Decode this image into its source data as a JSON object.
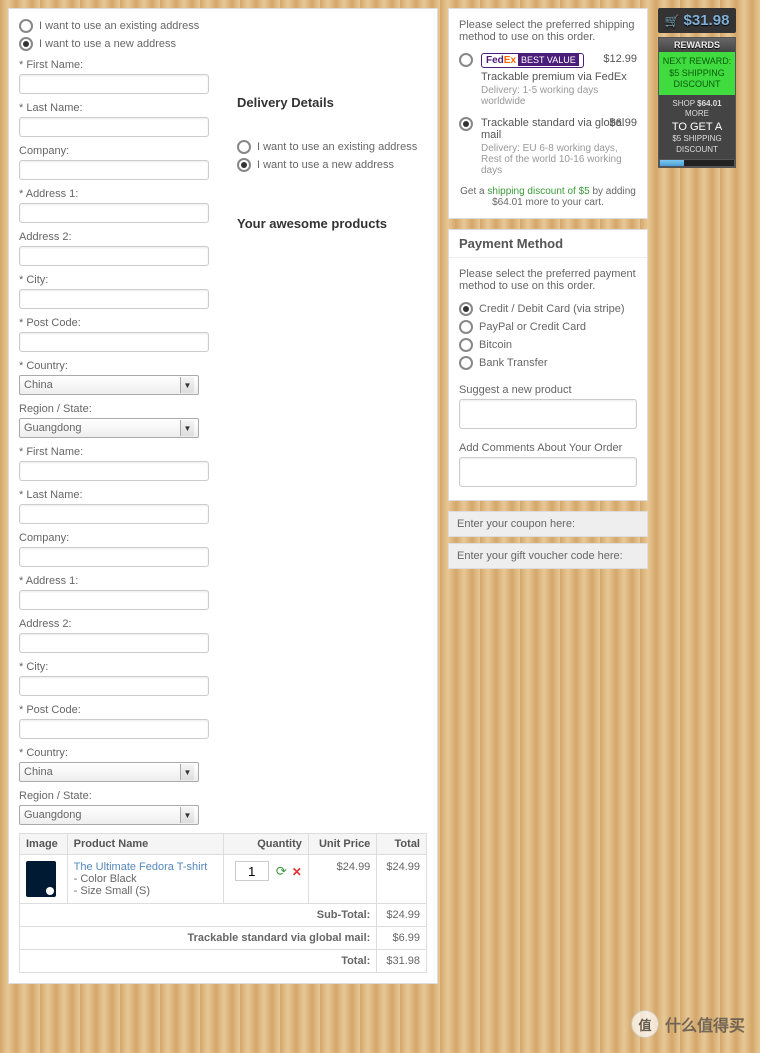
{
  "billing": {
    "use_existing": "I want to use an existing address",
    "use_new": "I want to use a new address",
    "first_name_label": "* First Name:",
    "last_name_label": "* Last Name:",
    "company_label": "Company:",
    "address1_label": "* Address 1:",
    "address2_label": "Address 2:",
    "city_label": "* City:",
    "postcode_label": "* Post Code:",
    "country_label": "* Country:",
    "country_value": "China",
    "region_label": "Region / State:",
    "region_value": "Guangdong"
  },
  "delivery": {
    "heading": "Delivery Details",
    "use_existing": "I want to use an existing address",
    "use_new": "I want to use a new address",
    "first_name_label": "* First Name:",
    "last_name_label": "* Last Name:",
    "company_label": "Company:",
    "address1_label": "* Address 1:",
    "address2_label": "Address 2:",
    "city_label": "* City:",
    "postcode_label": "* Post Code:",
    "country_label": "* Country:",
    "country_value": "China",
    "region_label": "Region / State:",
    "region_value": "Guangdong"
  },
  "products_heading": "Your awesome products",
  "shipping": {
    "instruction": "Please select the preferred shipping method to use on this order.",
    "fedex_brand": "FedEx",
    "fedex_best": "BEST VALUE",
    "fedex_title": "Trackable premium via FedEx",
    "fedex_sub": "Delivery: 1-5 working days worldwide",
    "fedex_price": "$12.99",
    "global_title": "Trackable standard via global mail",
    "global_sub": "Delivery: EU 6-8 working days, Rest of the world 10-16 working days",
    "global_price": "$6.99",
    "promo_pre": "Get a ",
    "promo_green": "shipping discount of $5",
    "promo_post": " by adding $64.01 more to your cart."
  },
  "payment": {
    "heading": "Payment Method",
    "instruction": "Please select the preferred payment method to use on this order.",
    "opt_card": "Credit / Debit Card (via stripe)",
    "opt_paypal": "PayPal or Credit Card",
    "opt_bitcoin": "Bitcoin",
    "opt_bank": "Bank Transfer",
    "suggest_label": "Suggest a new product",
    "comments_label": "Add Comments About Your Order"
  },
  "coupon_label": "Enter your coupon here:",
  "voucher_label": "Enter your gift voucher code here:",
  "cart": {
    "col_image": "Image",
    "col_name": "Product Name",
    "col_qty": "Quantity",
    "col_unit": "Unit Price",
    "col_total": "Total",
    "item_name": "The Ultimate Fedora T-shirt",
    "item_opt1": "- Color Black",
    "item_opt2": "- Size Small (S)",
    "item_qty": "1",
    "item_unit": "$24.99",
    "item_total": "$24.99",
    "subtotal_label": "Sub-Total:",
    "subtotal_val": "$24.99",
    "ship_label": "Trackable standard via global mail:",
    "ship_val": "$6.99",
    "total_label": "Total:",
    "total_val": "$31.98"
  },
  "sidebar": {
    "total": "$31.98",
    "rewards_head": "REWARDS",
    "rewards_next": "NEXT REWARD: $5 SHIPPING DISCOUNT",
    "rewards_shop_pre": "SHOP ",
    "rewards_shop_amt": "$64.01",
    "rewards_shop_post": " MORE",
    "rewards_toget": "TO GET A",
    "rewards_disc": "$5 SHIPPING DISCOUNT"
  },
  "watermark": {
    "circle": "值",
    "text": "什么值得买"
  }
}
